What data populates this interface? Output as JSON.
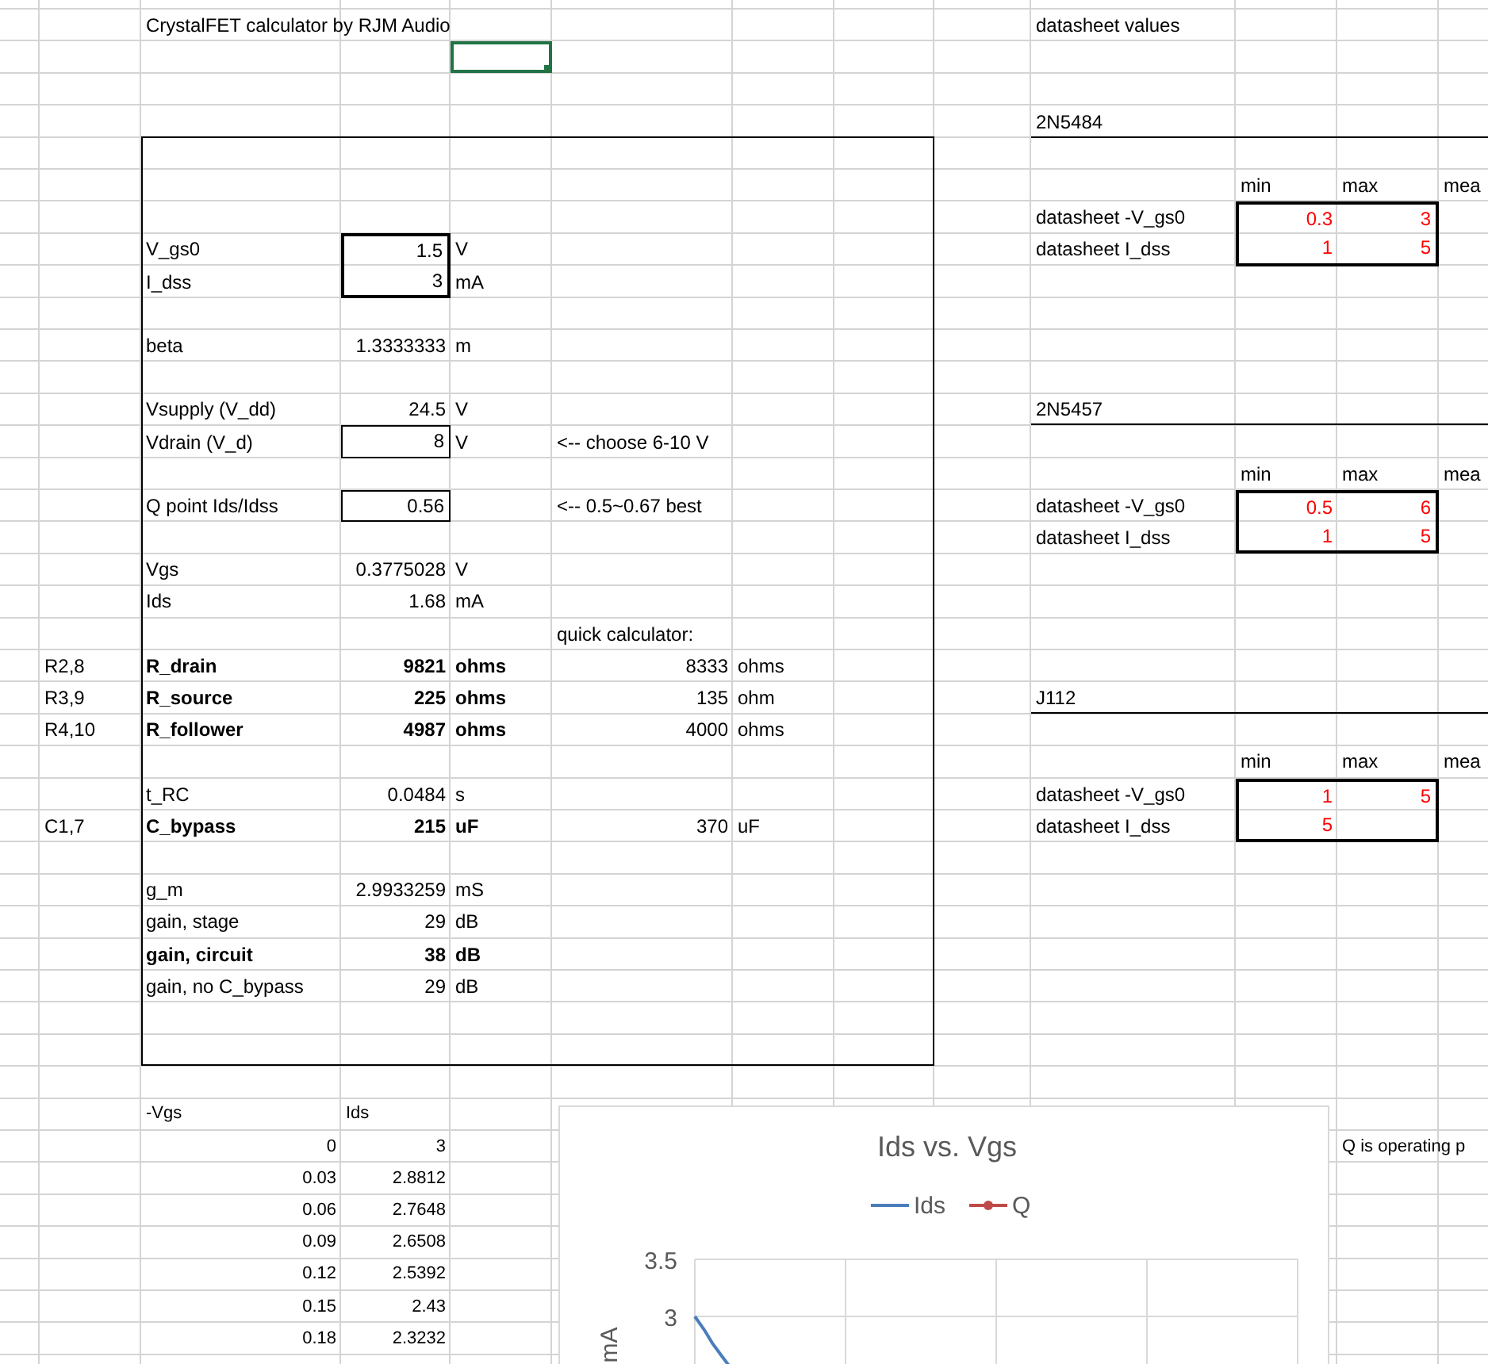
{
  "title": "CrystalFET calculator by RJM Audio",
  "calculator": {
    "sections": [
      {
        "rows": [
          {
            "label": "V_gs0",
            "value": "1.5",
            "unit": "V",
            "bold": false,
            "input": true
          },
          {
            "label": "I_dss",
            "value": "3",
            "unit": "mA",
            "bold": false,
            "input": true
          }
        ]
      },
      {
        "rows": [
          {
            "label": "beta",
            "value": "1.3333333",
            "unit": "m",
            "bold": false,
            "input": false
          }
        ]
      },
      {
        "rows": [
          {
            "label": "Vsupply (V_dd)",
            "value": "24.5",
            "unit": "V",
            "bold": false,
            "input": false
          },
          {
            "label": "Vdrain (V_d)",
            "value": "8",
            "unit": "V",
            "bold": false,
            "input": true,
            "note": "<-- choose 6-10 V"
          }
        ]
      },
      {
        "rows": [
          {
            "label": "Q point Ids/Idss",
            "value": "0.56",
            "bold": false,
            "input": true,
            "note": "<-- 0.5~0.67 best"
          }
        ]
      },
      {
        "rows": [
          {
            "label": "Vgs",
            "value": "0.3775028",
            "unit": "V",
            "bold": false,
            "input": false
          },
          {
            "label": "Ids",
            "value": "1.68",
            "unit": "mA",
            "bold": false,
            "input": false
          },
          {
            "note": "quick calculator:"
          },
          {
            "ref": "R2,8",
            "label": "R_drain",
            "value": "9821",
            "unit": "ohms",
            "bold": true,
            "input": false,
            "quick_value": "8333",
            "quick_unit": "ohms"
          },
          {
            "ref": "R3,9",
            "label": "R_source",
            "value": "225",
            "unit": "ohms",
            "bold": true,
            "input": false,
            "quick_value": "135",
            "quick_unit": "ohm"
          },
          {
            "ref": "R4,10",
            "label": "R_follower",
            "value": "4987",
            "unit": "ohms",
            "bold": true,
            "input": false,
            "quick_value": "4000",
            "quick_unit": "ohms"
          }
        ]
      },
      {
        "rows": [
          {
            "label": "t_RC",
            "value": "0.0484",
            "unit": "s",
            "bold": false,
            "input": false
          },
          {
            "ref": "C1,7",
            "label": "C_bypass",
            "value": "215",
            "unit": "uF",
            "bold": true,
            "input": false,
            "quick_value": "370",
            "quick_unit": "uF"
          }
        ]
      },
      {
        "rows": [
          {
            "label": "g_m",
            "value": "2.9933259",
            "unit": "mS",
            "bold": false,
            "input": false
          },
          {
            "label": "gain, stage",
            "value": "29",
            "unit": "dB",
            "bold": false,
            "input": false
          },
          {
            "label": "gain, circuit",
            "value": "38",
            "unit": "dB",
            "bold": true,
            "input": false
          },
          {
            "label": "gain, no C_bypass",
            "value": "29",
            "unit": "dB",
            "bold": false,
            "input": false
          }
        ]
      }
    ]
  },
  "datasheet": {
    "heading": "datasheet values",
    "parts": [
      {
        "name": "2N5484",
        "columns": [
          "min",
          "max",
          "mea"
        ],
        "rows": [
          {
            "label": "datasheet -V_gs0",
            "values": [
              "0.3",
              "3"
            ]
          },
          {
            "label": "datasheet I_dss",
            "values": [
              "1",
              "5"
            ]
          }
        ]
      },
      {
        "name": "2N5457",
        "columns": [
          "min",
          "max",
          "mea"
        ],
        "rows": [
          {
            "label": "datasheet -V_gs0",
            "values": [
              "0.5",
              "6"
            ]
          },
          {
            "label": "datasheet I_dss",
            "values": [
              "1",
              "5"
            ]
          }
        ]
      },
      {
        "name": "J112",
        "columns": [
          "min",
          "max",
          "mea"
        ],
        "rows": [
          {
            "label": "datasheet -V_gs0",
            "values": [
              "1",
              "5"
            ]
          },
          {
            "label": "datasheet I_dss",
            "values": [
              "5"
            ]
          }
        ]
      }
    ]
  },
  "sweep_table": {
    "columns": [
      "-Vgs",
      "Ids"
    ],
    "rows": [
      [
        "0",
        "3"
      ],
      [
        "0.03",
        "2.8812"
      ],
      [
        "0.06",
        "2.7648"
      ],
      [
        "0.09",
        "2.6508"
      ],
      [
        "0.12",
        "2.5392"
      ],
      [
        "0.15",
        "2.43"
      ],
      [
        "0.18",
        "2.3232"
      ]
    ]
  },
  "chart": {
    "title": "Ids vs. Vgs",
    "legend": [
      {
        "name": "Ids",
        "color": "#4a7ebb",
        "kind": "line"
      },
      {
        "name": "Q",
        "color": "#be4b48",
        "kind": "marker-line"
      }
    ],
    "y_ticks": [
      "3.5",
      "3"
    ],
    "y_axis_label": "mA"
  },
  "side_note": "Q is operating p"
}
